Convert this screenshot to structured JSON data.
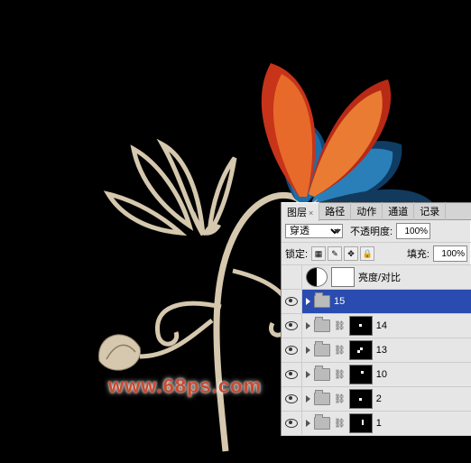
{
  "watermark": "www.68ps.com",
  "panel": {
    "tabs": {
      "layers": "图层",
      "paths": "路径",
      "actions": "动作",
      "channels": "通道",
      "history": "记录"
    },
    "blend_mode": "穿透",
    "opacity_label": "不透明度:",
    "opacity_value": "100%",
    "lock_label": "锁定:",
    "fill_label": "填充:",
    "fill_value": "100%",
    "adjustment_layer_name": "亮度/对比",
    "layers": [
      {
        "name": "15",
        "type": "group",
        "visible": true,
        "selected": true
      },
      {
        "name": "14",
        "type": "group",
        "visible": true,
        "linked": true
      },
      {
        "name": "13",
        "type": "group",
        "visible": true,
        "linked": true
      },
      {
        "name": "10",
        "type": "group",
        "visible": true,
        "linked": true
      },
      {
        "name": "2",
        "type": "group",
        "visible": true,
        "linked": true
      },
      {
        "name": "1",
        "type": "group",
        "visible": true,
        "linked": true
      }
    ]
  }
}
